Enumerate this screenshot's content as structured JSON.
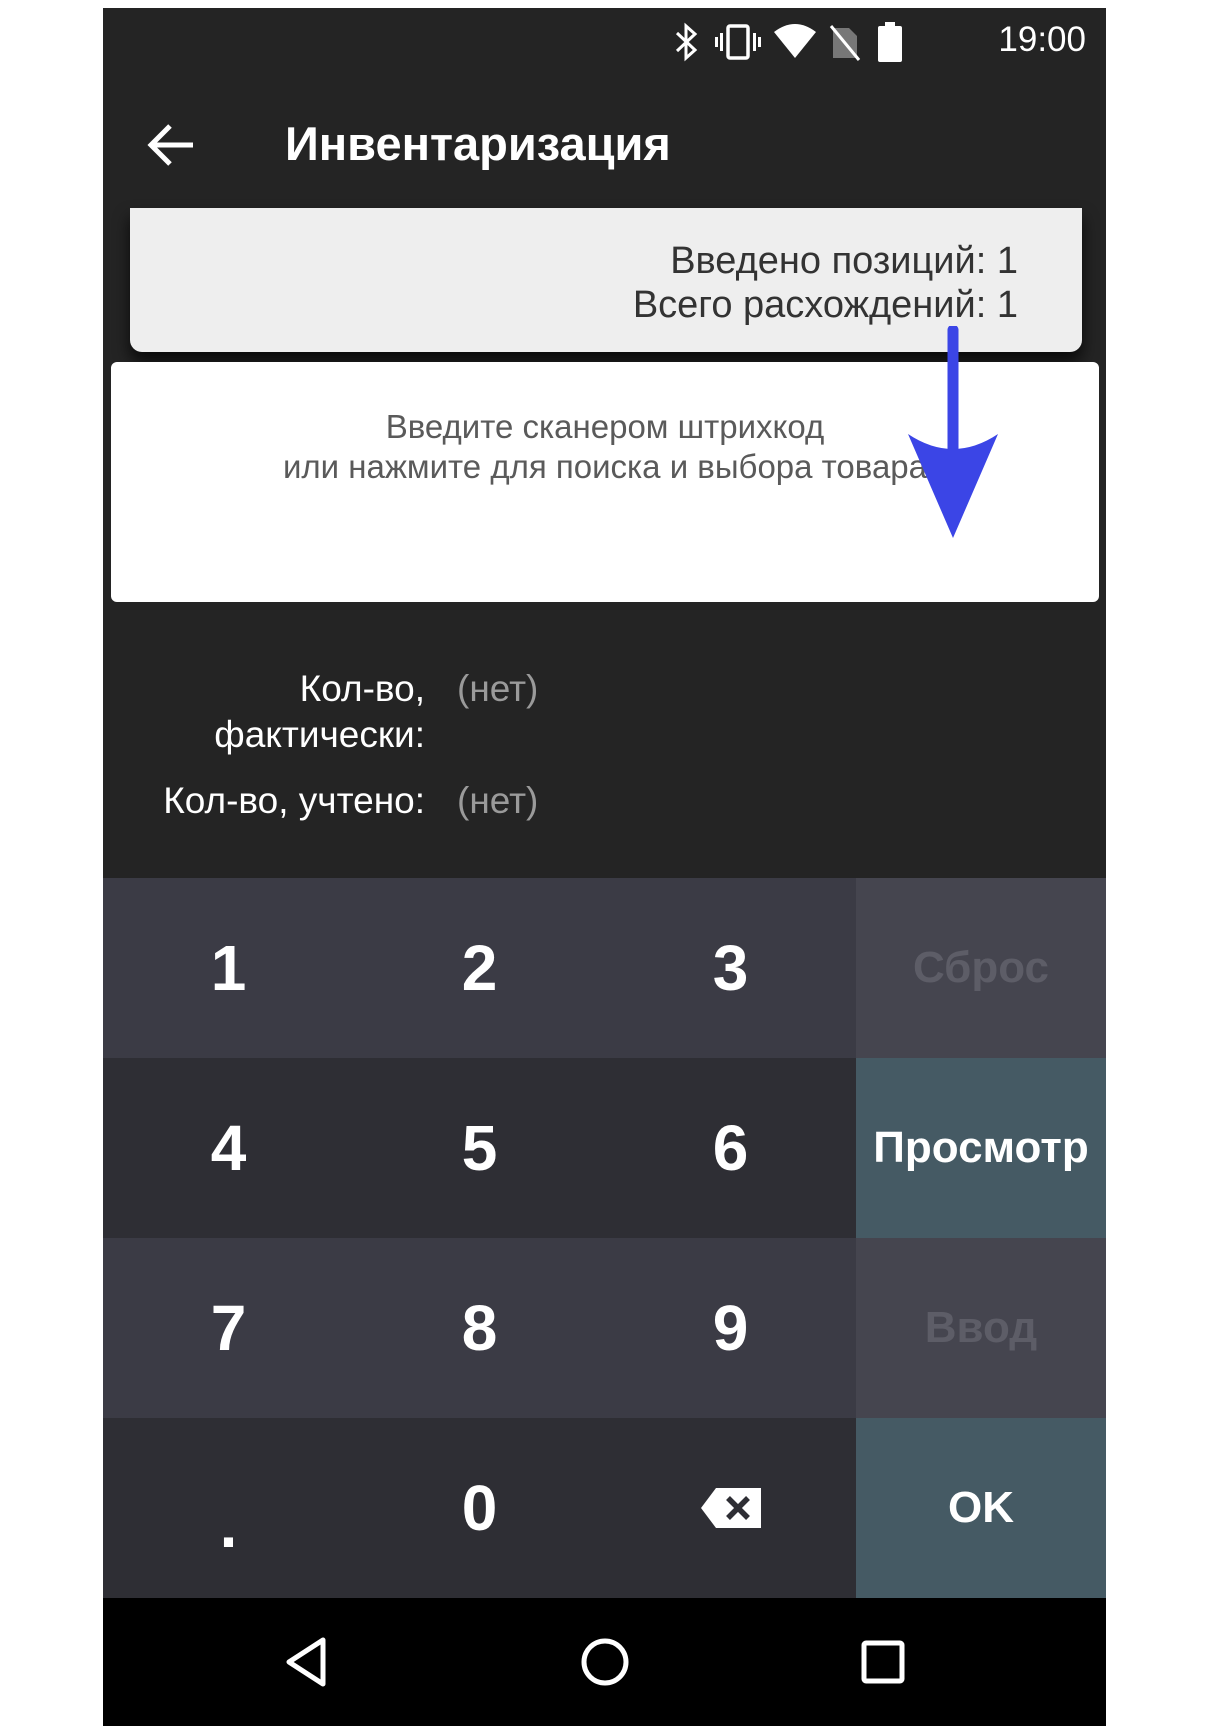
{
  "status_bar": {
    "time": "19:00",
    "icons": [
      "bluetooth-icon",
      "vibrate-icon",
      "wifi-icon",
      "no-sim-icon",
      "battery-icon"
    ]
  },
  "app_bar": {
    "back_icon": "arrow-left-icon",
    "title": "Инвентаризация"
  },
  "summary": {
    "entered_positions": "Введено позиций: 1",
    "total_discrepancies": "Всего расхождений: 1"
  },
  "barcode_panel": {
    "hint_line1": "Введите сканером штрихкод",
    "hint_line2": "или нажмите для поиска и выбора товара"
  },
  "annotation": {
    "icon": "arrow-down-icon",
    "color": "#3b45e6"
  },
  "quantities": {
    "actual_label_line1": "Кол-во,",
    "actual_label_line2": "фактически:",
    "actual_value": "(нет)",
    "accounted_label": "Кол-во, учтено:",
    "accounted_value": "(нет)"
  },
  "keypad": {
    "keys": [
      "1",
      "2",
      "3",
      "4",
      "5",
      "6",
      "7",
      "8",
      "9",
      ".",
      "0"
    ],
    "backspace_icon": "backspace-icon",
    "reset_label": "Сброс",
    "view_label": "Просмотр",
    "enter_label": "Ввод",
    "ok_label": "OK"
  },
  "nav_bar": {
    "icons": [
      "back-triangle-icon",
      "home-circle-icon",
      "recents-square-icon"
    ]
  },
  "colors": {
    "background": "#242424",
    "keypad_light": "#3b3b45",
    "keypad_dark": "#2e2e34",
    "side_active": "#455a64",
    "side_disabled": "#45454f"
  }
}
